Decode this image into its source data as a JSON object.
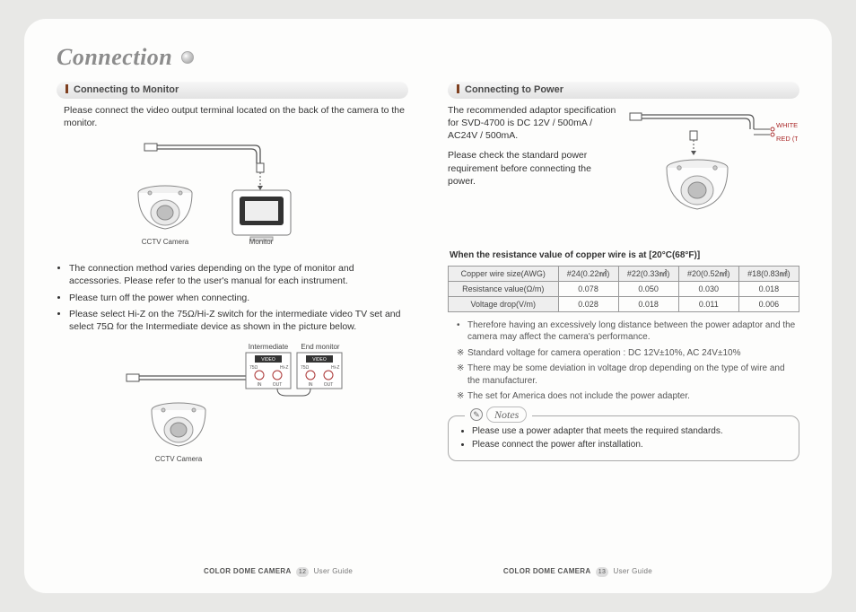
{
  "title": "Connection",
  "left": {
    "heading": "Connecting to Monitor",
    "intro": "Please connect the video output terminal located on the back of the camera to the monitor.",
    "fig1": {
      "camera": "CCTV Camera",
      "monitor": "Monitor"
    },
    "bullets": [
      "The connection method varies depending on the type of monitor and accessories. Please refer to the user's manual for each instrument.",
      "Please turn off the power when connecting.",
      "Please select Hi-Z on the 75Ω/Hi-Z switch for the intermediate video TV set and select 75Ω for the Intermediate device as shown in the picture below."
    ],
    "fig2": {
      "camera": "CCTV Camera",
      "intermediate": "Intermediate",
      "endmonitor": "End monitor",
      "video": "VIDEO",
      "hiZ": "Hi-Z",
      "z75": "75Ω",
      "in": "IN",
      "out": "OUT"
    }
  },
  "right": {
    "heading": "Connecting to Power",
    "intro1": "The recommended adaptor specification for SVD-4700 is DC 12V / 500mA / AC24V / 500mA.",
    "intro2": "Please check the standard power requirement before connecting the power.",
    "wire_white": "WHITE (TRX−)",
    "wire_red": "RED (TRX+)",
    "table_caption": "When the resistance value of copper wire is at [20°C(68°F)]",
    "table": {
      "headers": [
        "Copper wire size(AWG)",
        "#24(0.22㎟)",
        "#22(0.33㎟)",
        "#20(0.52㎟)",
        "#18(0.83㎟)"
      ],
      "rows": [
        {
          "label": "Resistance value(Ω/m)",
          "cells": [
            "0.078",
            "0.050",
            "0.030",
            "0.018"
          ]
        },
        {
          "label": "Voltage drop(V/m)",
          "cells": [
            "0.028",
            "0.018",
            "0.011",
            "0.006"
          ]
        }
      ]
    },
    "after_table_bullet": "Therefore having an excessively long distance between the power adaptor and the camera may affect the camera's performance.",
    "stars": [
      "Standard voltage for camera operation : DC 12V±10%, AC 24V±10%",
      "There may be some deviation in voltage drop depending on the type of wire and the manufacturer.",
      "The set for America does not include the power adapter."
    ],
    "notes_label": "Notes",
    "notes": [
      "Please use a power adapter that meets the required standards.",
      "Please connect the power after installation."
    ]
  },
  "footer": {
    "product": "COLOR DOME CAMERA",
    "guide": "User Guide",
    "page_left": "12",
    "page_right": "13"
  }
}
